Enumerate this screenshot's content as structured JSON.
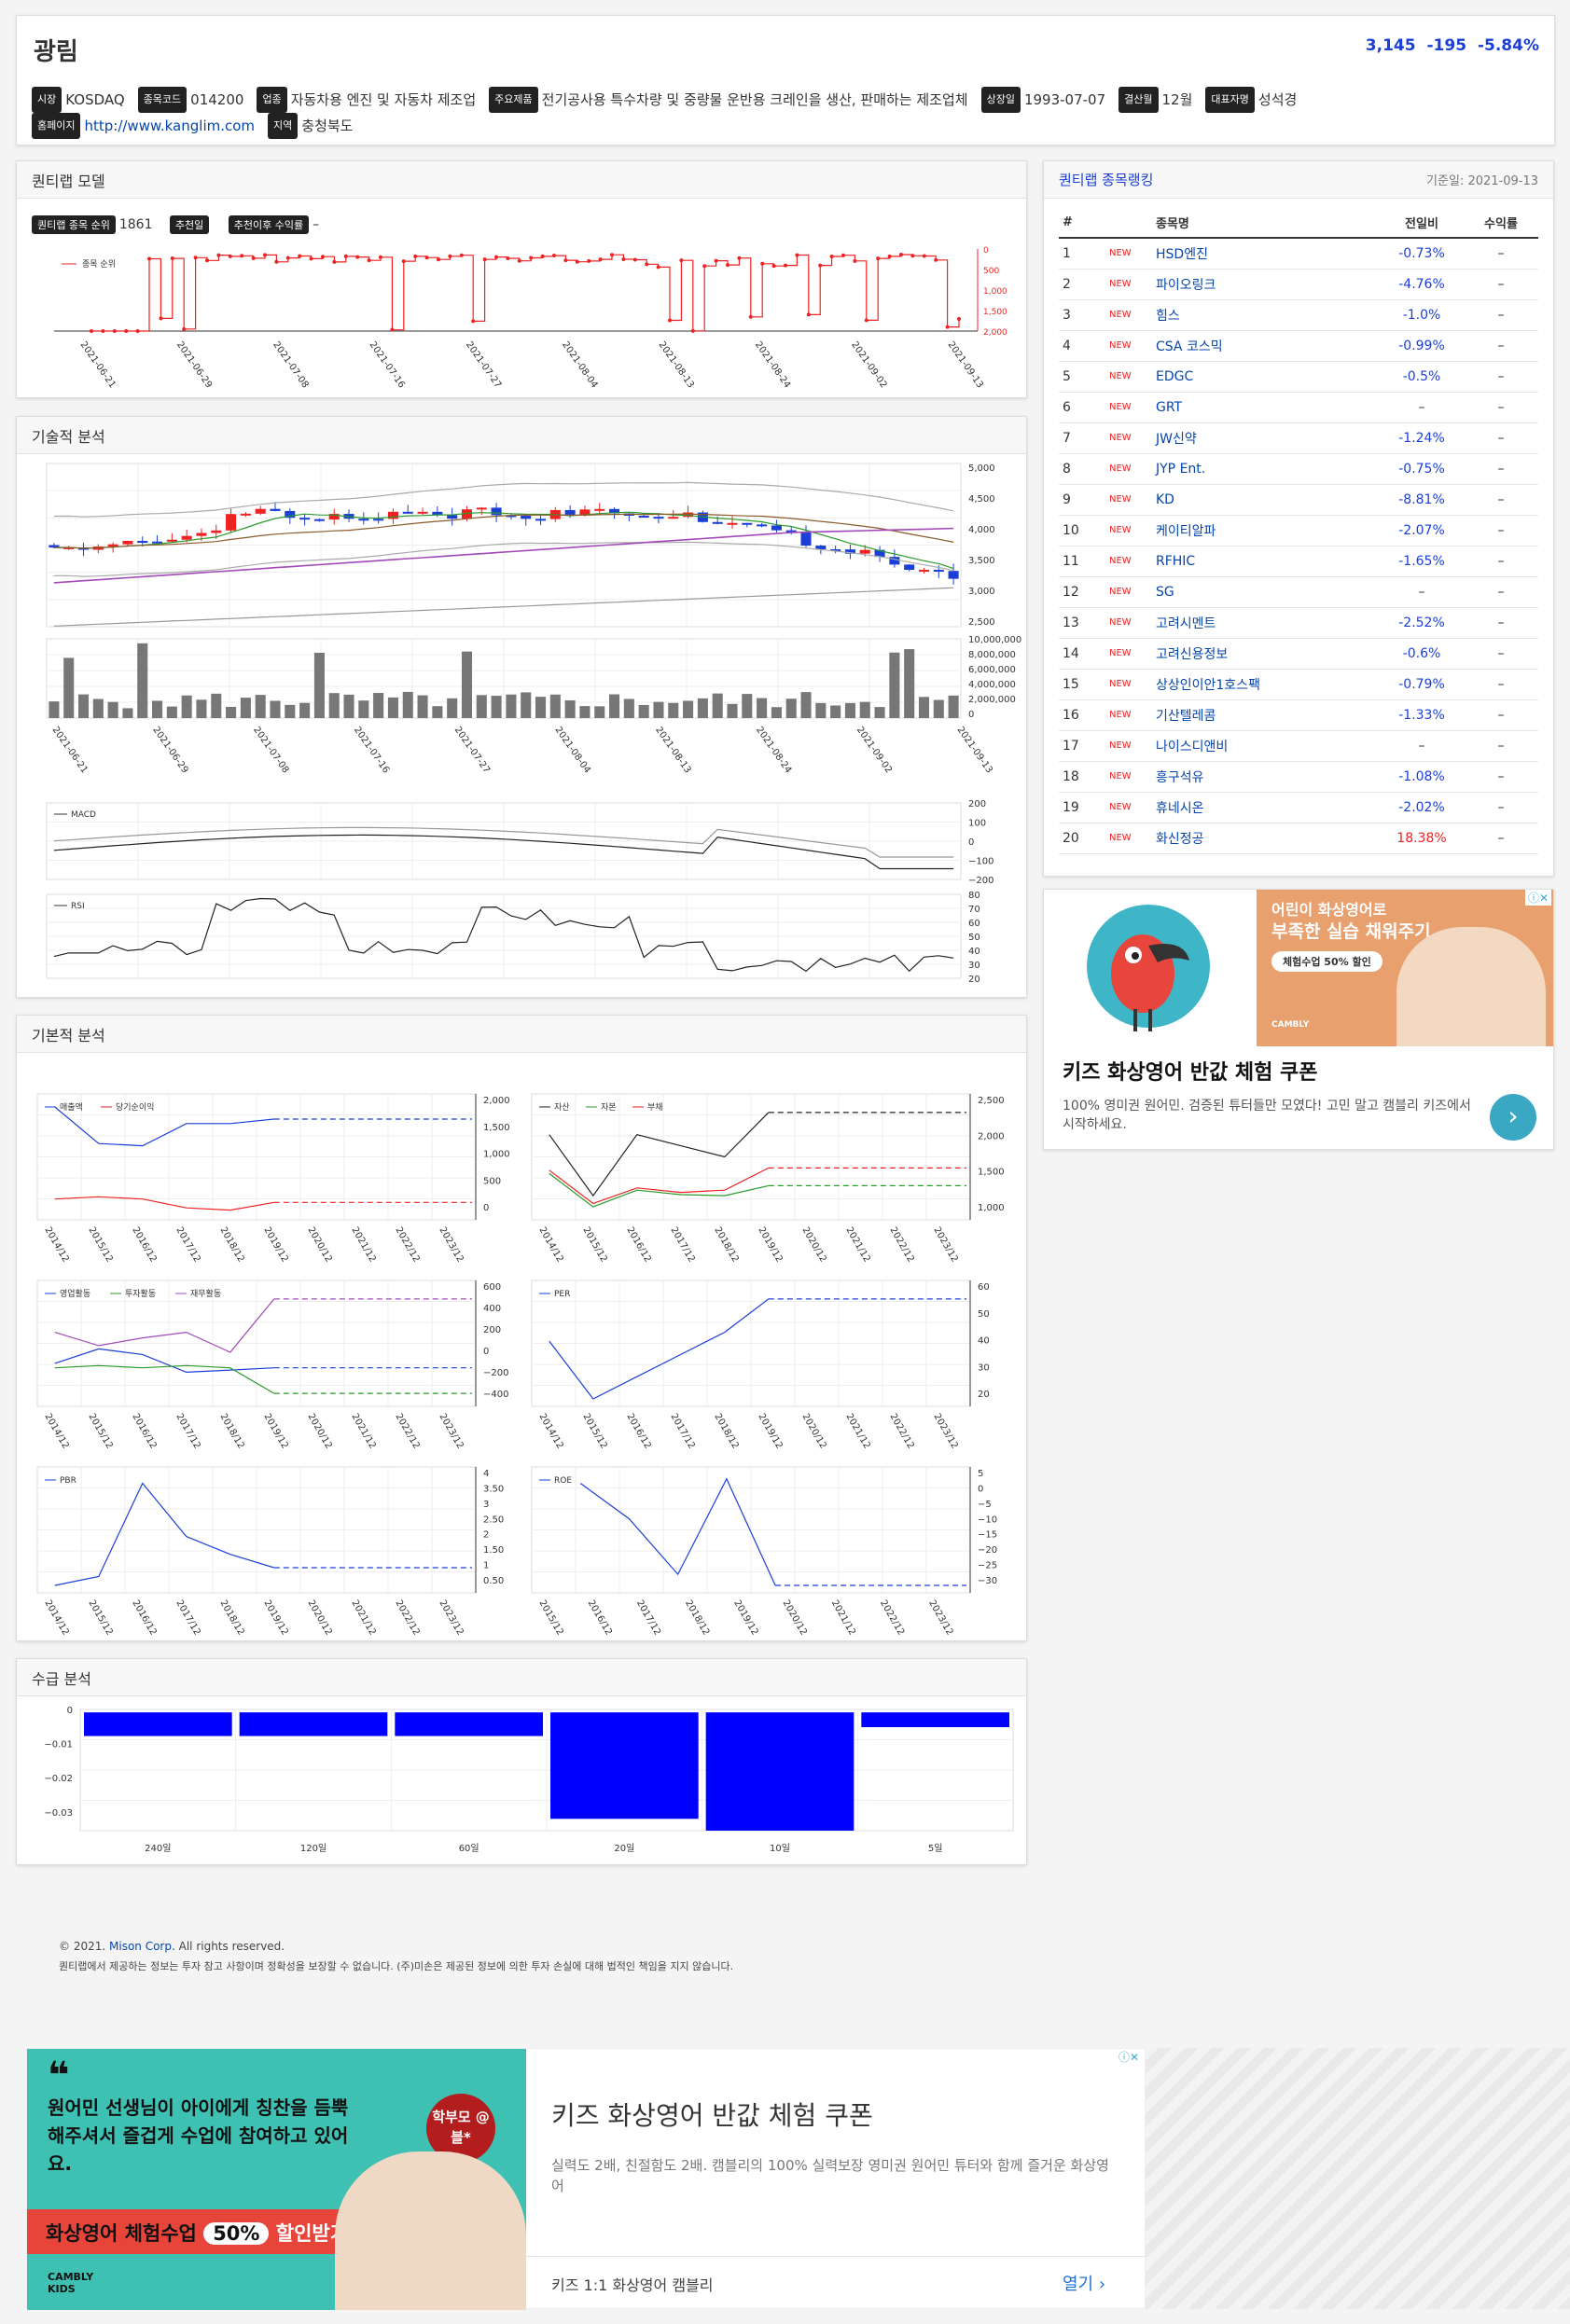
{
  "header": {
    "name": "광림",
    "price": "3,145",
    "change": "-195",
    "change_pct": "-5.84%",
    "fields": [
      {
        "label": "시장",
        "value": "KOSDAQ"
      },
      {
        "label": "종목코드",
        "value": "014200"
      },
      {
        "label": "업종",
        "value": "자동차용 엔진 및 자동차 제조업"
      },
      {
        "label": "주요제품",
        "value": "전기공사용 특수차량 및 중량물 운반용 크레인을 생산, 판매하는 제조업체"
      },
      {
        "label": "상장일",
        "value": "1993-07-07"
      },
      {
        "label": "결산월",
        "value": "12월"
      },
      {
        "label": "대표자명",
        "value": "성석경"
      },
      {
        "label": "홈페이지",
        "value": "http://www.kanglim.com"
      },
      {
        "label": "지역",
        "value": "충청북도"
      }
    ]
  },
  "model": {
    "title": "퀀티랩 모델",
    "rank_label": "퀀티랩 종목 순위",
    "rank_value": "1861",
    "rec_label": "추천일",
    "return_label": "추천이후 수익률",
    "return_value": "–",
    "legend": "종목 순위",
    "yticks": [
      "0",
      "500",
      "1,000",
      "1,500",
      "2,000"
    ],
    "dates": [
      "2021-06-21",
      "2021-06-29",
      "2021-07-08",
      "2021-07-16",
      "2021-07-27",
      "2021-08-04",
      "2021-08-13",
      "2021-08-24",
      "2021-09-02",
      "2021-09-13"
    ]
  },
  "tech": {
    "title": "기술적 분석",
    "price_ticks": [
      "5,000",
      "4,500",
      "4,000",
      "3,500",
      "3,000",
      "2,500"
    ],
    "vol_ticks": [
      "10,000,000",
      "8,000,000",
      "6,000,000",
      "4,000,000",
      "2,000,000",
      "0"
    ],
    "macd_label": "MACD",
    "macd_ticks": [
      "200",
      "100",
      "0",
      "−100",
      "−200"
    ],
    "rsi_label": "RSI",
    "rsi_ticks": [
      "80",
      "70",
      "60",
      "50",
      "40",
      "30",
      "20"
    ],
    "dates": [
      "2021-06-21",
      "2021-06-29",
      "2021-07-08",
      "2021-07-16",
      "2021-07-27",
      "2021-08-04",
      "2021-08-13",
      "2021-08-24",
      "2021-09-02",
      "2021-09-13"
    ]
  },
  "fund": {
    "title": "기본적 분석",
    "years1": [
      "2014/12",
      "2015/12",
      "2016/12",
      "2017/12",
      "2018/12",
      "2019/12",
      "2020/12",
      "2021/12",
      "2022/12",
      "2023/12"
    ],
    "years2": [
      "2015/12",
      "2016/12",
      "2017/12",
      "2018/12",
      "2019/12",
      "2020/12",
      "2021/12",
      "2022/12",
      "2023/12"
    ],
    "c1": {
      "legend": [
        "매출액",
        "당기순이익"
      ],
      "ticks": [
        "2,000",
        "1,500",
        "1,000",
        "500",
        "0"
      ]
    },
    "c2": {
      "legend": [
        "자산",
        "자본",
        "부채"
      ],
      "ticks": [
        "2,500",
        "2,000",
        "1,500",
        "1,000"
      ]
    },
    "c3": {
      "legend": [
        "영업활동",
        "투자활동",
        "재무활동"
      ],
      "ticks": [
        "600",
        "400",
        "200",
        "0",
        "−200",
        "−400"
      ]
    },
    "c4": {
      "legend": [
        "PER"
      ],
      "ticks": [
        "60",
        "50",
        "40",
        "30",
        "20"
      ]
    },
    "c5": {
      "legend": [
        "PBR"
      ],
      "ticks": [
        "4",
        "3.50",
        "3",
        "2.50",
        "2",
        "1.50",
        "1",
        "0.50"
      ]
    },
    "c6": {
      "legend": [
        "ROE"
      ],
      "ticks": [
        "5",
        "0",
        "−5",
        "−10",
        "−15",
        "−20",
        "−25",
        "−30"
      ]
    }
  },
  "supply": {
    "title": "수급 분석",
    "yticks": [
      "0",
      "−0.01",
      "−0.02",
      "−0.03"
    ],
    "chart_data": {
      "type": "bar",
      "categories": [
        "240일",
        "120일",
        "60일",
        "20일",
        "10일",
        "5일"
      ],
      "values": [
        -0.008,
        -0.008,
        -0.008,
        -0.036,
        -0.04,
        -0.005
      ],
      "ylim": [
        -0.04,
        0.001
      ]
    }
  },
  "ranking": {
    "title": "퀀티랩 종목랭킹",
    "date": "기준일: 2021-09-13",
    "cols": [
      "#",
      "종목명",
      "전일비",
      "수익률"
    ],
    "rows": [
      {
        "n": "1",
        "tag": "NEW",
        "name": "HSD엔진",
        "chg": "-0.73%",
        "ret": "–"
      },
      {
        "n": "2",
        "tag": "NEW",
        "name": "파이오링크",
        "chg": "-4.76%",
        "ret": "–"
      },
      {
        "n": "3",
        "tag": "NEW",
        "name": "힘스",
        "chg": "-1.0%",
        "ret": "–"
      },
      {
        "n": "4",
        "tag": "NEW",
        "name": "CSA 코스믹",
        "chg": "-0.99%",
        "ret": "–"
      },
      {
        "n": "5",
        "tag": "NEW",
        "name": "EDGC",
        "chg": "-0.5%",
        "ret": "–"
      },
      {
        "n": "6",
        "tag": "NEW",
        "name": "GRT",
        "chg": "–",
        "ret": "–"
      },
      {
        "n": "7",
        "tag": "NEW",
        "name": "JW신약",
        "chg": "-1.24%",
        "ret": "–"
      },
      {
        "n": "8",
        "tag": "NEW",
        "name": "JYP Ent.",
        "chg": "-0.75%",
        "ret": "–"
      },
      {
        "n": "9",
        "tag": "NEW",
        "name": "KD",
        "chg": "-8.81%",
        "ret": "–"
      },
      {
        "n": "10",
        "tag": "NEW",
        "name": "케이티알파",
        "chg": "-2.07%",
        "ret": "–"
      },
      {
        "n": "11",
        "tag": "NEW",
        "name": "RFHIC",
        "chg": "-1.65%",
        "ret": "–"
      },
      {
        "n": "12",
        "tag": "NEW",
        "name": "SG",
        "chg": "–",
        "ret": "–"
      },
      {
        "n": "13",
        "tag": "NEW",
        "name": "고려시멘트",
        "chg": "-2.52%",
        "ret": "–"
      },
      {
        "n": "14",
        "tag": "NEW",
        "name": "고려신용정보",
        "chg": "-0.6%",
        "ret": "–"
      },
      {
        "n": "15",
        "tag": "NEW",
        "name": "상상인이안1호스팩",
        "chg": "-0.79%",
        "ret": "–"
      },
      {
        "n": "16",
        "tag": "NEW",
        "name": "기산텔레콤",
        "chg": "-1.33%",
        "ret": "–"
      },
      {
        "n": "17",
        "tag": "NEW",
        "name": "나이스디앤비",
        "chg": "–",
        "ret": "–"
      },
      {
        "n": "18",
        "tag": "NEW",
        "name": "흥구석유",
        "chg": "-1.08%",
        "ret": "–"
      },
      {
        "n": "19",
        "tag": "NEW",
        "name": "휴네시온",
        "chg": "-2.02%",
        "ret": "–"
      },
      {
        "n": "20",
        "tag": "NEW",
        "name": "화신정공",
        "chg": "18.38%",
        "ret": "–"
      }
    ]
  },
  "ad1": {
    "banner_top": "어린이 화상영어로",
    "banner_main": "부족한 실습 채워주기",
    "banner_pill": "체험수업 50% 할인",
    "logo": "CAMBLY",
    "title": "키즈 화상영어 반값 체험 쿠폰",
    "desc": "100% 영미권 원어민. 검증된 튜터들만 모였다! 고민 말고 캠블리 키즈에서 시작하세요."
  },
  "footer": {
    "copyright_pre": "© 2021.",
    "company": "Mison Corp.",
    "copyright_post": "All rights reserved.",
    "disclaimer": "퀀티랩에서 제공하는 정보는 투자 참고 사항이며 정확성을 보장할 수 없습니다. (주)미손은 제공된 정보에 의한 투자 손실에 대해 법적인 책임을 지지 않습니다."
  },
  "ad2": {
    "quote": "원어민 선생님이 아이에게 칭찬을 듬뿍 해주셔서 즐겁게 수업에 참여하고 있어요.",
    "bubble": "학부모 @블*",
    "promo_pre": "화상영어 체험수업",
    "promo_pct": "50%",
    "promo_post": "할인받기",
    "logo": "CAMBLY",
    "logo_sub": "KIDS",
    "title": "키즈 화상영어 반값 체험 쿠폰",
    "desc": "실력도 2배, 친절함도 2배. 캠블리의 100% 실력보장 영미권 원어민 튜터와 함께 즐거운 화상영어",
    "source": "키즈 1:1 화상영어 캠블리",
    "cta": "열기"
  },
  "colors": {
    "accent": "#1b3fd6",
    "up": "#e22222",
    "down": "#1b3fd6"
  }
}
